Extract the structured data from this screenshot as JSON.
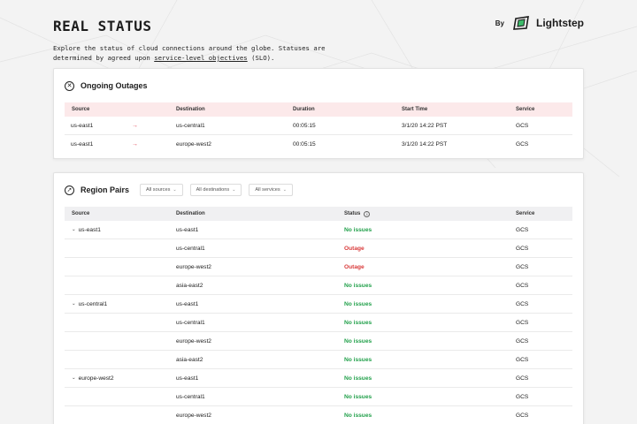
{
  "header": {
    "title": "REAL STATUS",
    "description_pre": "Explore the status of cloud connections around the globe. Statuses are determined by agreed upon ",
    "description_link": "service-level objectives",
    "description_post": " (SLO).",
    "brand_by": "By",
    "brand_name": "Lightstep"
  },
  "outages": {
    "title": "Ongoing Outages",
    "columns": [
      "Source",
      "Destination",
      "Duration",
      "Start Time",
      "Service"
    ],
    "rows": [
      {
        "source": "us-east1",
        "destination": "us-central1",
        "duration": "00:05:15",
        "start": "3/1/20 14:22 PST",
        "service": "GCS"
      },
      {
        "source": "us-east1",
        "destination": "europe-west2",
        "duration": "00:05:15",
        "start": "3/1/20 14:22 PST",
        "service": "GCS"
      }
    ]
  },
  "region_pairs": {
    "title": "Region Pairs",
    "filters": [
      "All sources",
      "All destinations",
      "All services"
    ],
    "columns": [
      "Source",
      "Destination",
      "Status",
      "Service"
    ],
    "rows": [
      {
        "source": "us-east1",
        "destination": "us-east1",
        "status": "No issues",
        "ok": true,
        "service": "GCS"
      },
      {
        "source": "",
        "destination": "us-central1",
        "status": "Outage",
        "ok": false,
        "service": "GCS"
      },
      {
        "source": "",
        "destination": "europe-west2",
        "status": "Outage",
        "ok": false,
        "service": "GCS"
      },
      {
        "source": "",
        "destination": "asia-east2",
        "status": "No issues",
        "ok": true,
        "service": "GCS"
      },
      {
        "source": "us-central1",
        "destination": "us-east1",
        "status": "No issues",
        "ok": true,
        "service": "GCS"
      },
      {
        "source": "",
        "destination": "us-central1",
        "status": "No issues",
        "ok": true,
        "service": "GCS"
      },
      {
        "source": "",
        "destination": "europe-west2",
        "status": "No issues",
        "ok": true,
        "service": "GCS"
      },
      {
        "source": "",
        "destination": "asia-east2",
        "status": "No issues",
        "ok": true,
        "service": "GCS"
      },
      {
        "source": "europe-west2",
        "destination": "us-east1",
        "status": "No issues",
        "ok": true,
        "service": "GCS"
      },
      {
        "source": "",
        "destination": "us-central1",
        "status": "No issues",
        "ok": true,
        "service": "GCS"
      },
      {
        "source": "",
        "destination": "europe-west2",
        "status": "No issues",
        "ok": true,
        "service": "GCS"
      }
    ]
  },
  "colors": {
    "ok": "#21a04a",
    "outage": "#d93a3a",
    "outage_header": "#fce9ea",
    "arrow": "#e04b5b",
    "brand": "#3dbb6a"
  },
  "icons": {
    "outages": "x-circle-icon",
    "regions": "compass-icon",
    "brand": "lightstep-logo",
    "status_info": "info-icon",
    "row_toggle": "chevron-down-icon",
    "filter": "chevron-down-icon"
  }
}
